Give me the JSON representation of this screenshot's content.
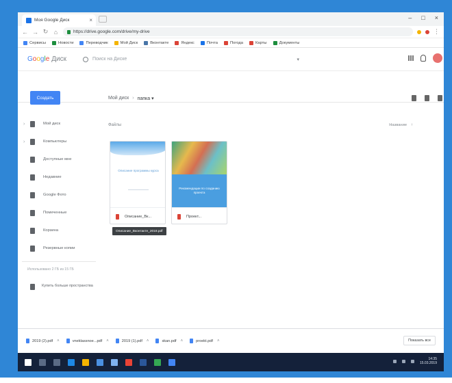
{
  "browser": {
    "tab_title": "Моя Google Диск",
    "tab_close": "×",
    "window_controls": [
      "–",
      "□",
      "×"
    ],
    "url": "https://drive.google.com/drive/my-drive",
    "bookmarks": [
      {
        "label": "Сервисы",
        "color": "#4285f4"
      },
      {
        "label": "Новости",
        "color": "#1e8e3e"
      },
      {
        "label": "Переводчик",
        "color": "#4285f4"
      },
      {
        "label": "Мой Диск",
        "color": "#f4b400"
      },
      {
        "label": "Вконтакте",
        "color": "#4a76a8"
      },
      {
        "label": "Яндекс",
        "color": "#db4437"
      },
      {
        "label": "Почта",
        "color": "#1a73e8"
      },
      {
        "label": "Погода",
        "color": "#db4437"
      },
      {
        "label": "Карты",
        "color": "#db4437"
      },
      {
        "label": "Документы",
        "color": "#1e8e3e"
      }
    ]
  },
  "drive": {
    "logo_letters": [
      {
        "ch": "G",
        "color": "#4285f4"
      },
      {
        "ch": "o",
        "color": "#ea4335"
      },
      {
        "ch": "o",
        "color": "#fbbc05"
      },
      {
        "ch": "g",
        "color": "#4285f4"
      },
      {
        "ch": "l",
        "color": "#34a853"
      },
      {
        "ch": "e",
        "color": "#ea4335"
      }
    ],
    "logo_product": "Диск",
    "search_placeholder": "Поиск на Диске",
    "search_dropdown": "▾",
    "new_button": "Создать",
    "breadcrumb": {
      "root": "Мой диск",
      "sep": "›",
      "current": "папка ▾"
    },
    "sidebar": [
      {
        "label": "Мой диск",
        "icon": "drive-icon",
        "chevron": "›"
      },
      {
        "label": "Компьютеры",
        "icon": "computer-icon",
        "chevron": "›"
      },
      {
        "label": "Доступные мне",
        "icon": "shared-icon"
      },
      {
        "label": "Недавние",
        "icon": "clock-icon"
      },
      {
        "label": "Google Фото",
        "icon": "photos-icon"
      },
      {
        "label": "Помеченные",
        "icon": "star-icon"
      },
      {
        "label": "Корзина",
        "icon": "trash-icon"
      }
    ],
    "sidebar_extra": {
      "label": "Резервные копии",
      "icon": "backup-icon"
    },
    "storage_text": "Использовано 2 ГБ из 15 ГБ",
    "upgrade": {
      "label": "Купить больше пространства",
      "icon": "storage-icon"
    },
    "section_label": "Файлы",
    "sort_label": "Название",
    "sort_arrow": "↑",
    "files": [
      {
        "name": "Описание_Вк...",
        "thumb_title": "Описание программы курса"
      },
      {
        "name": "Проект...",
        "thumb_title": "Рекомендации по созданию проекта"
      }
    ],
    "tooltip": "Описание_Вконтакте_2018.pdf"
  },
  "downloads": {
    "items": [
      "2019 (2).pdf",
      "vneklassnoe...pdf",
      "2019 (1).pdf",
      "skan.pdf",
      "proekt.pdf"
    ],
    "caret": "˄",
    "show_all": "Показать все"
  },
  "taskbar": {
    "apps": [
      {
        "name": "start",
        "color": "#ffffff"
      },
      {
        "name": "search",
        "color": "#5b6b85"
      },
      {
        "name": "task-view",
        "color": "#5b6b85"
      },
      {
        "name": "edge",
        "color": "#1e88e5"
      },
      {
        "name": "explorer",
        "color": "#f4b400"
      },
      {
        "name": "store",
        "color": "#4a90e2"
      },
      {
        "name": "mail",
        "color": "#7fb2f0"
      },
      {
        "name": "chrome",
        "color": "#ea4335"
      },
      {
        "name": "word",
        "color": "#2b579a"
      },
      {
        "name": "photos",
        "color": "#34a853"
      },
      {
        "name": "app",
        "color": "#4285f4"
      }
    ],
    "time": "14:35",
    "date": "15.03.2019"
  }
}
